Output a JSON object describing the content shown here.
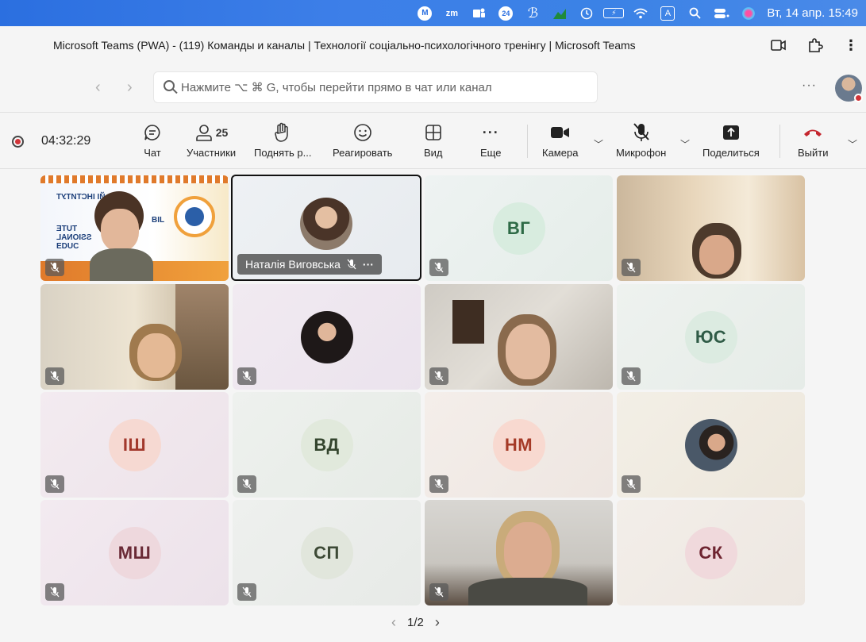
{
  "menubar": {
    "icons": [
      "mail-icon",
      "zoom-icon",
      "teams-icon",
      "calendar-24-icon",
      "script-icon",
      "chart-icon",
      "timemachine-icon",
      "battery-icon",
      "wifi-icon",
      "input-source-icon",
      "spotlight-icon",
      "control-center-icon",
      "siri-icon"
    ],
    "zm_label": "zm",
    "cal_label": "24",
    "input_label": "A",
    "clock": "Вт, 14 апр.  15:49"
  },
  "window": {
    "title": "Microsoft Teams (PWA) - (119) Команды и каналы | Технології соціально-психологічного тренінгу | Microsoft Teams"
  },
  "search": {
    "placeholder": "Нажмите ⌥ ⌘ G, чтобы перейти прямо в чат или канал"
  },
  "toolbar": {
    "timer": "04:32:29",
    "chat": "Чат",
    "participants": "Участники",
    "participants_count": "25",
    "raise_hand": "Поднять р...",
    "react": "Реагировать",
    "view": "Вид",
    "more": "Еще",
    "camera": "Камера",
    "mic": "Микрофон",
    "share": "Поделиться",
    "leave": "Выйти"
  },
  "tiles": {
    "t2_name": "Наталія Виговська",
    "initials": {
      "vg": "ВГ",
      "yus": "ЮС",
      "ish": "ІШ",
      "vd": "ВД",
      "nm": "НМ",
      "msh": "МШ",
      "sp": "СП",
      "sk": "СК"
    },
    "banner": {
      "line1": "ЙІ ІНСТИТУТ",
      "line2": "BIL",
      "line3": "TUTE",
      "line4": "SSIONAL",
      "line5": "EDUC"
    }
  },
  "pager": {
    "label": "1/2"
  },
  "colors": {
    "accent_red": "#d13438",
    "menubar_blue": "#3b7fe6"
  }
}
